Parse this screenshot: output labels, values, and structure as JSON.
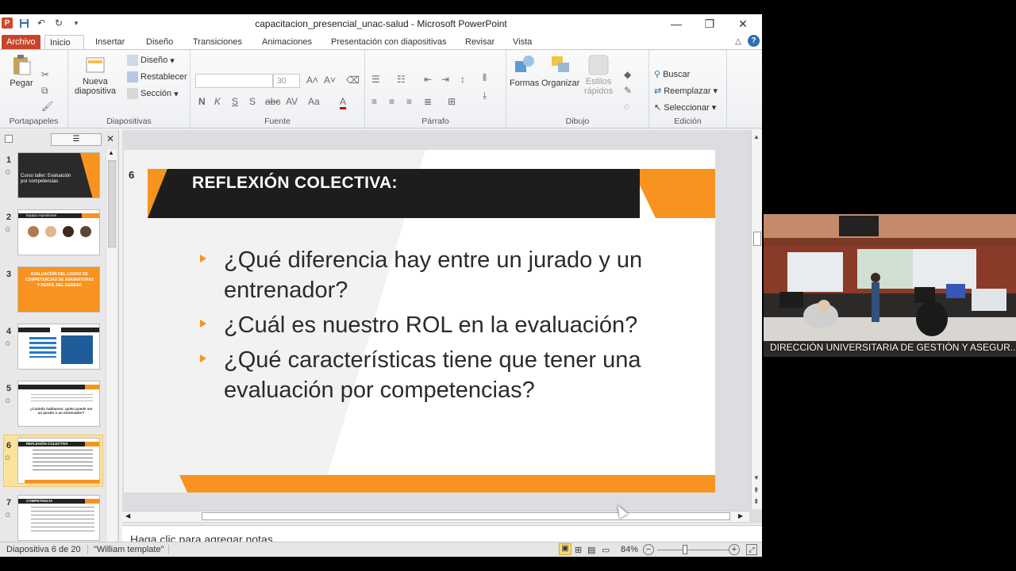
{
  "window": {
    "title": "capacitacion_presencial_unac-salud  -  Microsoft PowerPoint",
    "app_icon": "P"
  },
  "tabs": [
    "Archivo",
    "Inicio",
    "Insertar",
    "Diseño",
    "Transiciones",
    "Animaciones",
    "Presentación con diapositivas",
    "Revisar",
    "Vista"
  ],
  "ribbon": {
    "portapapeles": {
      "paste": "Pegar",
      "label": "Portapapeles"
    },
    "diapositivas": {
      "new_slide": "Nueva",
      "new_slide2": "diapositiva",
      "layout": "Diseño",
      "reset": "Restablecer",
      "section": "Sección",
      "label": "Diapositivas"
    },
    "fuente": {
      "font_size": "30",
      "label": "Fuente"
    },
    "parrafo": {
      "label": "Párrafo"
    },
    "dibujo": {
      "shapes": "Formas",
      "arrange": "Organizar",
      "styles": "Estilos",
      "styles2": "rápidos",
      "label": "Dibujo"
    },
    "edicion": {
      "find": "Buscar",
      "replace": "Reemplazar",
      "select": "Seleccionar",
      "label": "Edición"
    }
  },
  "thumbnails": [
    {
      "num": "1",
      "text": "Curso taller: Evaluación por competencias"
    },
    {
      "num": "2",
      "text": "Equipo expositores"
    },
    {
      "num": "3",
      "text": "EVALUACIÓN DEL LOGRO DE COMPETENCIAS DE ASIGNATURAS Y PERFIL DEL EGRESO"
    },
    {
      "num": "4",
      "text": ""
    },
    {
      "num": "5",
      "text": "¿Cuándo hablamos: quién puede ser un jurado o un entrenador?"
    },
    {
      "num": "6",
      "text": "REFLEXIÓN COLECTIVA"
    },
    {
      "num": "7",
      "text": "COMPETENCIA"
    }
  ],
  "slide": {
    "number": "6",
    "title": "REFLEXIÓN COLECTIVA:",
    "bullets": [
      "¿Qué diferencia hay entre un jurado y un entrenador?",
      "¿Cuál es nuestro ROL en la evaluación?",
      "¿Qué características tiene que tener una evaluación por competencias?"
    ]
  },
  "notes_placeholder": "Haga clic para agregar notas",
  "status": {
    "slide_position": "Diapositiva 6 de 20",
    "theme": "\"William template\"",
    "zoom": "84%"
  },
  "video": {
    "caption": "DIRECCIÓN UNIVERSITARIA DE GESTIÓN Y ASEGUR..."
  },
  "colors": {
    "accent_orange": "#f7931e",
    "dark_header": "#1d1d1d",
    "file_tab": "#c8452b"
  }
}
